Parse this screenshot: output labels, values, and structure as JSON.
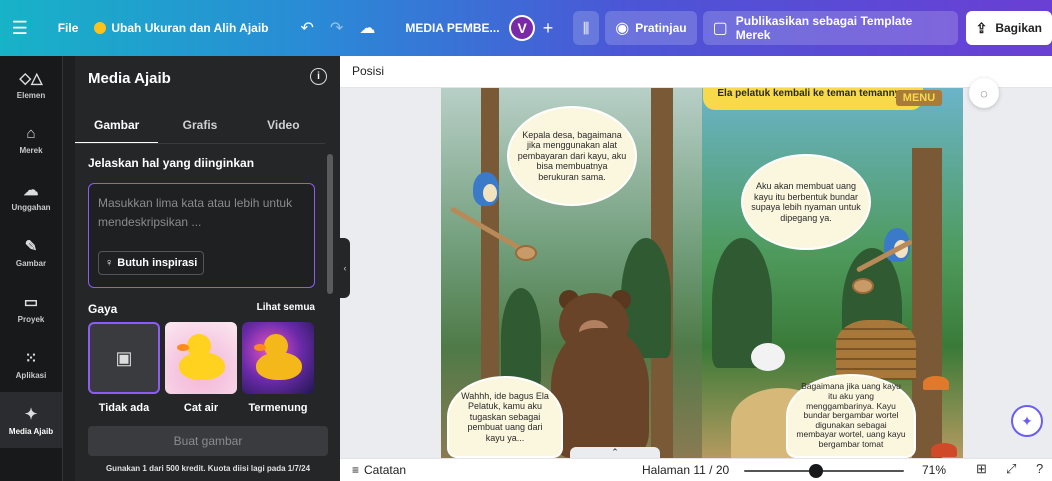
{
  "topbar": {
    "menu_icon": "hamburger-icon",
    "file_label": "File",
    "resize_label": "Ubah Ukuran dan Alih Ajaib",
    "undo_icon": "undo-icon",
    "redo_icon": "redo-icon",
    "cloud_icon": "cloud-check-icon",
    "doc_title": "MEDIA PEMBE...",
    "avatar_initial": "V",
    "add_icon": "plus-icon",
    "stats_icon": "bar-chart-icon",
    "preview_label": "Pratinjau",
    "publish_label": "Publikasikan sebagai Template Merek",
    "share_label": "Bagikan"
  },
  "rail": {
    "items": [
      {
        "label": "Elemen",
        "icon": "shapes-icon"
      },
      {
        "label": "Merek",
        "icon": "brand-icon"
      },
      {
        "label": "Unggahan",
        "icon": "cloud-upload-icon"
      },
      {
        "label": "Gambar",
        "icon": "draw-icon"
      },
      {
        "label": "Proyek",
        "icon": "folder-icon"
      },
      {
        "label": "Aplikasi",
        "icon": "apps-icon"
      },
      {
        "label": "Media Ajaib",
        "icon": "magic-media-icon"
      }
    ]
  },
  "panel": {
    "title": "Media Ajaib",
    "tabs": [
      "Gambar",
      "Grafis",
      "Video"
    ],
    "prompt_label": "Jelaskan hal yang diinginkan",
    "prompt_placeholder": "Masukkan lima kata atau lebih untuk mendeskripsikan ...",
    "inspiration_label": "Butuh inspirasi",
    "style_label": "Gaya",
    "see_all_label": "Lihat semua",
    "styles": [
      "Tidak ada",
      "Cat air",
      "Termenung"
    ],
    "generate_label": "Buat gambar",
    "credit_text": "Gunakan 1 dari 500 kredit. Kuota diisi lagi pada 1/7/24"
  },
  "canvas": {
    "position_label": "Posisi",
    "top_banner": "Ela pelatuk kembali ke teman temannya.",
    "menu_sign": "MENU",
    "bubbles": {
      "left_top": "Kepala desa, bagaimana jika menggunakan alat pembayaran dari kayu, aku bisa membuatnya berukuran sama.",
      "left_bottom": "Wahhh, ide bagus Ela Pelatuk, kamu aku tugaskan sebagai pembuat uang dari kayu ya...",
      "right_top": "Aku akan membuat uang kayu itu berbentuk bundar supaya lebih nyaman untuk dipegang ya.",
      "right_bottom": "Bagaimana jika uang kayu itu aku yang menggambarinya. Kayu bundar bergambar wortel digunakan sebagai membayar wortel, uang kayu bergambar tomat"
    }
  },
  "bottombar": {
    "notes_label": "Catatan",
    "page_label": "Halaman 11 / 20",
    "zoom_level": 71,
    "zoom_label": "71%"
  },
  "colors": {
    "accent": "#8b5cf6",
    "panel_bg": "#252627",
    "rail_bg": "#18191b"
  }
}
